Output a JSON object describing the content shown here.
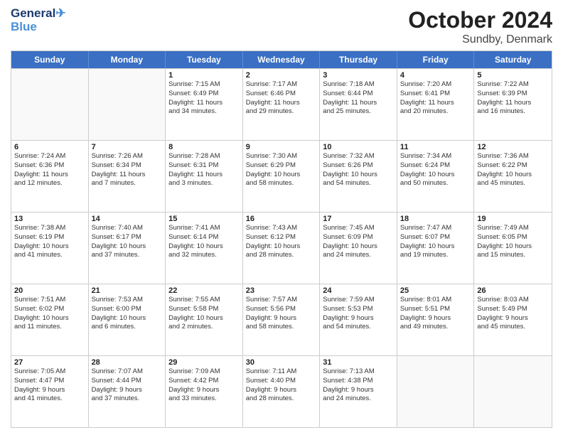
{
  "logo": {
    "line1": "General",
    "line2": "Blue"
  },
  "title": "October 2024",
  "subtitle": "Sundby, Denmark",
  "headers": [
    "Sunday",
    "Monday",
    "Tuesday",
    "Wednesday",
    "Thursday",
    "Friday",
    "Saturday"
  ],
  "weeks": [
    [
      {
        "day": "",
        "lines": []
      },
      {
        "day": "",
        "lines": []
      },
      {
        "day": "1",
        "lines": [
          "Sunrise: 7:15 AM",
          "Sunset: 6:49 PM",
          "Daylight: 11 hours",
          "and 34 minutes."
        ]
      },
      {
        "day": "2",
        "lines": [
          "Sunrise: 7:17 AM",
          "Sunset: 6:46 PM",
          "Daylight: 11 hours",
          "and 29 minutes."
        ]
      },
      {
        "day": "3",
        "lines": [
          "Sunrise: 7:18 AM",
          "Sunset: 6:44 PM",
          "Daylight: 11 hours",
          "and 25 minutes."
        ]
      },
      {
        "day": "4",
        "lines": [
          "Sunrise: 7:20 AM",
          "Sunset: 6:41 PM",
          "Daylight: 11 hours",
          "and 20 minutes."
        ]
      },
      {
        "day": "5",
        "lines": [
          "Sunrise: 7:22 AM",
          "Sunset: 6:39 PM",
          "Daylight: 11 hours",
          "and 16 minutes."
        ]
      }
    ],
    [
      {
        "day": "6",
        "lines": [
          "Sunrise: 7:24 AM",
          "Sunset: 6:36 PM",
          "Daylight: 11 hours",
          "and 12 minutes."
        ]
      },
      {
        "day": "7",
        "lines": [
          "Sunrise: 7:26 AM",
          "Sunset: 6:34 PM",
          "Daylight: 11 hours",
          "and 7 minutes."
        ]
      },
      {
        "day": "8",
        "lines": [
          "Sunrise: 7:28 AM",
          "Sunset: 6:31 PM",
          "Daylight: 11 hours",
          "and 3 minutes."
        ]
      },
      {
        "day": "9",
        "lines": [
          "Sunrise: 7:30 AM",
          "Sunset: 6:29 PM",
          "Daylight: 10 hours",
          "and 58 minutes."
        ]
      },
      {
        "day": "10",
        "lines": [
          "Sunrise: 7:32 AM",
          "Sunset: 6:26 PM",
          "Daylight: 10 hours",
          "and 54 minutes."
        ]
      },
      {
        "day": "11",
        "lines": [
          "Sunrise: 7:34 AM",
          "Sunset: 6:24 PM",
          "Daylight: 10 hours",
          "and 50 minutes."
        ]
      },
      {
        "day": "12",
        "lines": [
          "Sunrise: 7:36 AM",
          "Sunset: 6:22 PM",
          "Daylight: 10 hours",
          "and 45 minutes."
        ]
      }
    ],
    [
      {
        "day": "13",
        "lines": [
          "Sunrise: 7:38 AM",
          "Sunset: 6:19 PM",
          "Daylight: 10 hours",
          "and 41 minutes."
        ]
      },
      {
        "day": "14",
        "lines": [
          "Sunrise: 7:40 AM",
          "Sunset: 6:17 PM",
          "Daylight: 10 hours",
          "and 37 minutes."
        ]
      },
      {
        "day": "15",
        "lines": [
          "Sunrise: 7:41 AM",
          "Sunset: 6:14 PM",
          "Daylight: 10 hours",
          "and 32 minutes."
        ]
      },
      {
        "day": "16",
        "lines": [
          "Sunrise: 7:43 AM",
          "Sunset: 6:12 PM",
          "Daylight: 10 hours",
          "and 28 minutes."
        ]
      },
      {
        "day": "17",
        "lines": [
          "Sunrise: 7:45 AM",
          "Sunset: 6:09 PM",
          "Daylight: 10 hours",
          "and 24 minutes."
        ]
      },
      {
        "day": "18",
        "lines": [
          "Sunrise: 7:47 AM",
          "Sunset: 6:07 PM",
          "Daylight: 10 hours",
          "and 19 minutes."
        ]
      },
      {
        "day": "19",
        "lines": [
          "Sunrise: 7:49 AM",
          "Sunset: 6:05 PM",
          "Daylight: 10 hours",
          "and 15 minutes."
        ]
      }
    ],
    [
      {
        "day": "20",
        "lines": [
          "Sunrise: 7:51 AM",
          "Sunset: 6:02 PM",
          "Daylight: 10 hours",
          "and 11 minutes."
        ]
      },
      {
        "day": "21",
        "lines": [
          "Sunrise: 7:53 AM",
          "Sunset: 6:00 PM",
          "Daylight: 10 hours",
          "and 6 minutes."
        ]
      },
      {
        "day": "22",
        "lines": [
          "Sunrise: 7:55 AM",
          "Sunset: 5:58 PM",
          "Daylight: 10 hours",
          "and 2 minutes."
        ]
      },
      {
        "day": "23",
        "lines": [
          "Sunrise: 7:57 AM",
          "Sunset: 5:56 PM",
          "Daylight: 9 hours",
          "and 58 minutes."
        ]
      },
      {
        "day": "24",
        "lines": [
          "Sunrise: 7:59 AM",
          "Sunset: 5:53 PM",
          "Daylight: 9 hours",
          "and 54 minutes."
        ]
      },
      {
        "day": "25",
        "lines": [
          "Sunrise: 8:01 AM",
          "Sunset: 5:51 PM",
          "Daylight: 9 hours",
          "and 49 minutes."
        ]
      },
      {
        "day": "26",
        "lines": [
          "Sunrise: 8:03 AM",
          "Sunset: 5:49 PM",
          "Daylight: 9 hours",
          "and 45 minutes."
        ]
      }
    ],
    [
      {
        "day": "27",
        "lines": [
          "Sunrise: 7:05 AM",
          "Sunset: 4:47 PM",
          "Daylight: 9 hours",
          "and 41 minutes."
        ]
      },
      {
        "day": "28",
        "lines": [
          "Sunrise: 7:07 AM",
          "Sunset: 4:44 PM",
          "Daylight: 9 hours",
          "and 37 minutes."
        ]
      },
      {
        "day": "29",
        "lines": [
          "Sunrise: 7:09 AM",
          "Sunset: 4:42 PM",
          "Daylight: 9 hours",
          "and 33 minutes."
        ]
      },
      {
        "day": "30",
        "lines": [
          "Sunrise: 7:11 AM",
          "Sunset: 4:40 PM",
          "Daylight: 9 hours",
          "and 28 minutes."
        ]
      },
      {
        "day": "31",
        "lines": [
          "Sunrise: 7:13 AM",
          "Sunset: 4:38 PM",
          "Daylight: 9 hours",
          "and 24 minutes."
        ]
      },
      {
        "day": "",
        "lines": []
      },
      {
        "day": "",
        "lines": []
      }
    ]
  ]
}
